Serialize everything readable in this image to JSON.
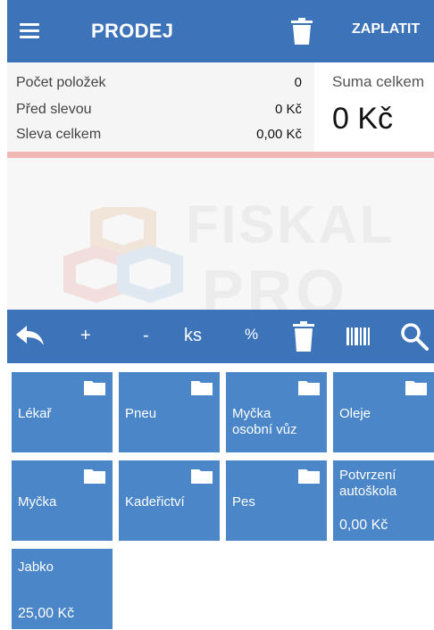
{
  "appbar": {
    "title": "PRODEJ",
    "pay_label": "ZAPLATIT",
    "menu_icon": "hamburger-menu-icon",
    "trash_icon": "trash-icon"
  },
  "summary": {
    "items_count_label": "Počet položek",
    "items_count_value": "0",
    "before_discount_label": "Před slevou",
    "before_discount_value": "0 Kč",
    "discount_total_label": "Sleva celkem",
    "discount_total_value": "0,00 Kč",
    "total_label": "Suma celkem",
    "total_value": "0 Kč"
  },
  "watermark": {
    "line1": "FISKAL",
    "line2": "PRO"
  },
  "toolbar": {
    "plus": "+",
    "minus": "-",
    "ks": "ks",
    "percent": "%"
  },
  "tiles": [
    {
      "label": "Lékař"
    },
    {
      "label": "Pneu"
    },
    {
      "label": "Myčka osobní vůz"
    },
    {
      "label": "Oleje"
    },
    {
      "label": "Myčka"
    },
    {
      "label": "Kadeřictví"
    },
    {
      "label": "Pes"
    },
    {
      "label": "Potvrzení autoškola",
      "price": "0,00 Kč"
    },
    {
      "label": "Jabko",
      "price": "25,00 Kč"
    }
  ],
  "colors": {
    "primary": "#3d73b9",
    "tile": "#4a86c8",
    "accent_line": "#f2b7b7"
  }
}
